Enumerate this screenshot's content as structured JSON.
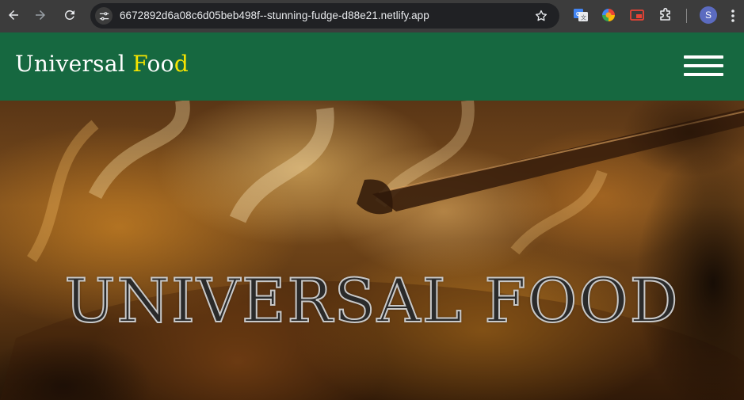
{
  "browser": {
    "url": "6672892d6a08c6d05beb498f--stunning-fudge-d88e21.netlify.app",
    "profile_initial": "S",
    "icons": {
      "back": "back-arrow-icon",
      "forward": "forward-arrow-icon",
      "reload": "reload-icon",
      "site_info": "tune-icon",
      "bookmark": "star-icon",
      "translate": "google-translate-icon",
      "ext_color": "color-picker-extension-icon",
      "ext_pip": "picture-in-picture-icon",
      "extensions": "puzzle-icon",
      "menu": "kebab-menu-icon"
    }
  },
  "site": {
    "logo_main": "Universal ",
    "logo_accent_1": "F",
    "logo_mid": "oo",
    "logo_accent_2": "d",
    "hero_title": "UNIVERSAL FOOD",
    "colors": {
      "header_bg": "#166840",
      "logo_text": "#ffffff",
      "logo_accent": "#f6e400"
    },
    "menu_icon": "hamburger-menu-icon"
  }
}
